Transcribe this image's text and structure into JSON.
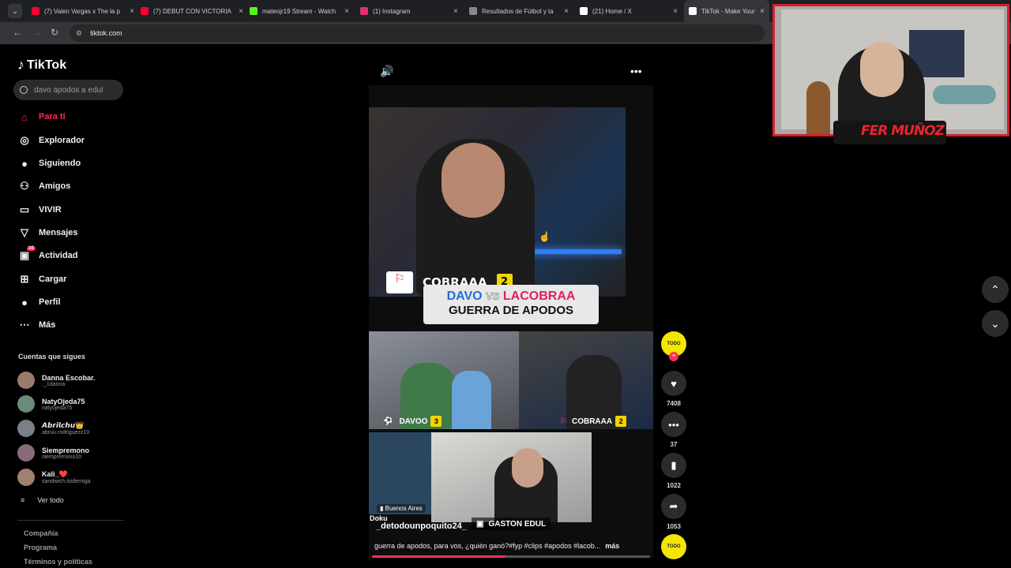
{
  "browser": {
    "tabs": [
      {
        "title": "(7) Valen Vargas x The la p",
        "color": "#ff0033"
      },
      {
        "title": "(7) DEBUT CON VICTORIA",
        "color": "#ff0033"
      },
      {
        "title": "mateojr19 Stream - Watch",
        "color": "#53fc18"
      },
      {
        "title": "(1) Instagram",
        "color": "#e1306c"
      },
      {
        "title": "Resultados de Fútbol y ta",
        "color": "#888888"
      },
      {
        "title": "(21) Home / X",
        "color": "#ffffff"
      },
      {
        "title": "TikTok - Make Your D",
        "color": "#ffffff"
      }
    ],
    "url": "tiktok.com"
  },
  "sidebar": {
    "brand": "TikTok",
    "search_placeholder": "davo apodos a edul",
    "nav": [
      {
        "label": "Para ti",
        "icon": "home-icon",
        "active": true
      },
      {
        "label": "Explorador",
        "icon": "compass-icon"
      },
      {
        "label": "Siguiendo",
        "icon": "avatar-icon"
      },
      {
        "label": "Amigos",
        "icon": "friends-icon"
      },
      {
        "label": "VIVIR",
        "icon": "live-icon"
      },
      {
        "label": "Mensajes",
        "icon": "send-icon"
      },
      {
        "label": "Actividad",
        "icon": "inbox-icon",
        "badge": "10"
      },
      {
        "label": "Cargar",
        "icon": "upload-icon"
      },
      {
        "label": "Perfil",
        "icon": "profile-avatar-icon"
      },
      {
        "label": "Más",
        "icon": "more-dots-icon"
      }
    ],
    "following_title": "Cuentas que sigues",
    "accounts": [
      {
        "name": "Danna Escobar.",
        "handle": "._1danna"
      },
      {
        "name": "NatyOjeda75",
        "handle": "natyojeda75"
      },
      {
        "name": "𝘼𝙗𝙧𝙞𝙡𝙘𝙝𝙪👑",
        "handle": "abruu.rodriguezz10"
      },
      {
        "name": "Siempremono",
        "handle": "siempremono10"
      },
      {
        "name": "Kali_❤️",
        "handle": "sandwich.itodemiga"
      }
    ],
    "see_all": "Ver todo",
    "footer": [
      "Compañía",
      "Programa",
      "Términos y políticas"
    ]
  },
  "video": {
    "tag_top": "COBRAAA",
    "tag_top_num": "2",
    "title_word_1": "DAVO",
    "title_vs": "VS",
    "title_word_2": "LACOBRAA",
    "title_line2": "GUERRA DE APODOS",
    "left_name": "DAVOO",
    "left_num": "3",
    "right_name": "COBRAAA",
    "right_num": "2",
    "bottom_name": "GASTON EDUL",
    "location": "Buenos Aires",
    "doku": "Doku",
    "author": "_detodounpoquito24_",
    "caption": "guerra de apodos, para vos, ¿quién ganó?#fyp #clips #apodos #lacob...",
    "more": "más",
    "progress": 0.48
  },
  "actions": {
    "likes": "7408",
    "comments": "37",
    "saves": "1022",
    "shares": "1053"
  },
  "webcam": {
    "name": "FER MUÑOZ"
  }
}
